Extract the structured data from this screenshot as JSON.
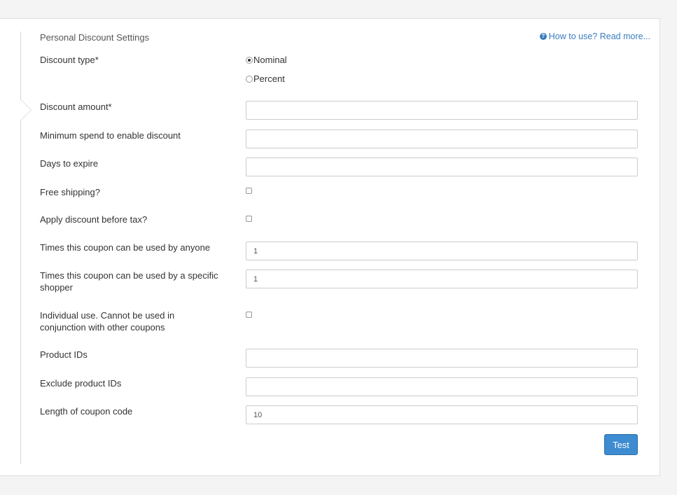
{
  "section": {
    "title": "Personal Discount Settings",
    "help_icon": "?",
    "help_link": "How to use? Read more..."
  },
  "form": {
    "discount_type": {
      "label": "Discount type*",
      "options": [
        "Nominal",
        "Percent"
      ],
      "selected": "Nominal"
    },
    "discount_amount": {
      "label": "Discount amount*",
      "value": ""
    },
    "minimum_spend": {
      "label": "Minimum spend to enable discount",
      "value": ""
    },
    "days_to_expire": {
      "label": "Days to expire",
      "value": ""
    },
    "free_shipping": {
      "label": "Free shipping?",
      "checked": false
    },
    "apply_before_tax": {
      "label": "Apply discount before tax?",
      "checked": false
    },
    "times_by_anyone": {
      "label": "Times this coupon can be used by anyone",
      "value": "1"
    },
    "times_by_shopper": {
      "label": "Times this coupon can be used by a specific shopper",
      "value": "1"
    },
    "individual_use": {
      "label": "Individual use. Cannot be used in conjunction with other coupons",
      "checked": false
    },
    "product_ids": {
      "label": "Product IDs",
      "value": ""
    },
    "exclude_product_ids": {
      "label": "Exclude product IDs",
      "value": ""
    },
    "coupon_length": {
      "label": "Length of coupon code",
      "value": "10"
    }
  },
  "actions": {
    "test_label": "Test"
  },
  "colors": {
    "accent": "#3d8bd0",
    "link": "#3a7dbd"
  }
}
